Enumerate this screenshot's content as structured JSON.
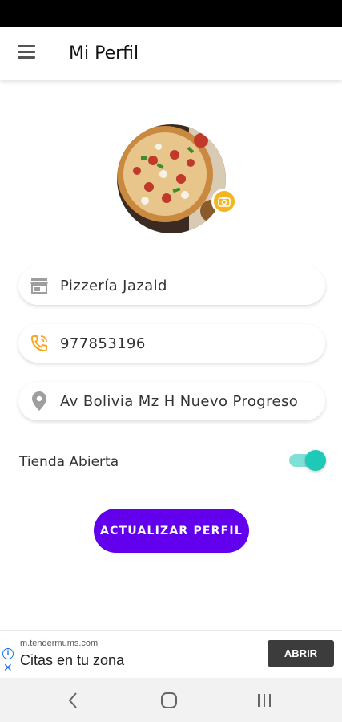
{
  "app_bar": {
    "title": "Mi Perfil"
  },
  "profile": {
    "store_name": "Pizzería Jazald",
    "phone": "977853196",
    "address": "Av Bolivia Mz H Nuevo Progreso"
  },
  "store_status": {
    "label": "Tienda Abierta",
    "open": true
  },
  "actions": {
    "update_label": "ACTUALIZAR PERFIL"
  },
  "ad": {
    "url": "m.tendermums.com",
    "title": "Citas en tu zona",
    "cta": "ABRIR"
  },
  "colors": {
    "primary": "#6200ee",
    "accent": "#1fc9b7",
    "camera_badge": "#f5b521",
    "phone_icon": "#f5a623"
  },
  "icons": {
    "menu": "menu-icon",
    "store": "store-icon",
    "phone": "phone-icon",
    "location": "location-pin-icon",
    "camera": "camera-icon"
  }
}
